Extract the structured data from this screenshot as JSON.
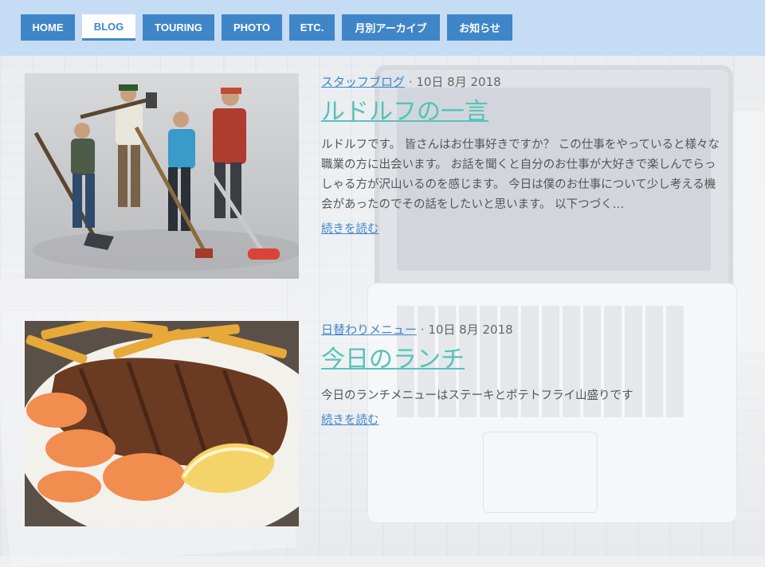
{
  "nav": {
    "items": [
      {
        "label": "HOME",
        "active": false
      },
      {
        "label": "BLOG",
        "active": true
      },
      {
        "label": "TOURING",
        "active": false
      },
      {
        "label": "PHOTO",
        "active": false
      },
      {
        "label": "ETC.",
        "active": false
      },
      {
        "label": "月別アーカイブ",
        "active": false
      },
      {
        "label": "お知らせ",
        "active": false
      }
    ]
  },
  "posts": [
    {
      "category": "スタッフブログ",
      "date": "10日 8月 2018",
      "title": "ルドルフの一言",
      "excerpt": "ルドルフです。 皆さんはお仕事好きですか？ この仕事をやっていると様々な職業の方に出会います。 お話を聞くと自分のお仕事が大好きで楽しんでらっしゃる方が沢山いるのを感じます。 今日は僕のお仕事について少し考える機会があったのでその話をしたいと思います。 以下つづく…",
      "more": "続きを読む"
    },
    {
      "category": "日替わりメニュー",
      "date": "10日 8月 2018",
      "title": "今日のランチ",
      "excerpt": "今日のランチメニューはステーキとポテトフライ山盛りです",
      "more": "続きを読む"
    }
  ],
  "colors": {
    "nav_bg": "#c6dcf4",
    "nav_button": "#3f86c9",
    "title": "#55c3b8",
    "link": "#3f86c9"
  }
}
